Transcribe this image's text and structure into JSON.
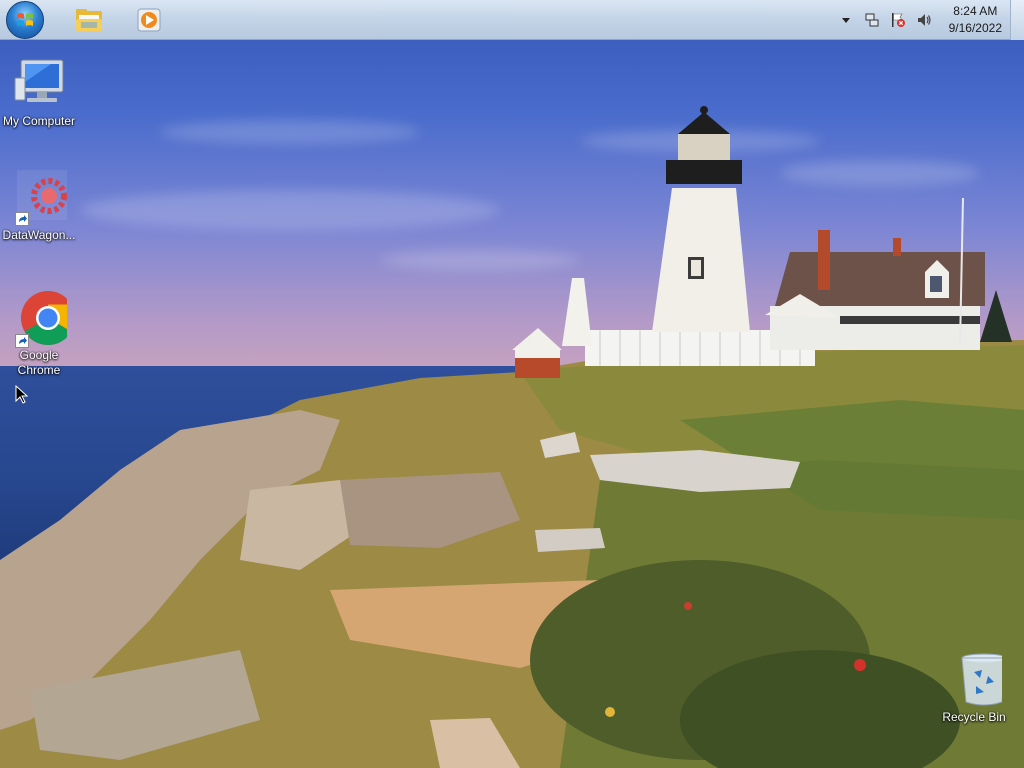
{
  "taskbar": {
    "start_button": "start-orb",
    "pinned": [
      {
        "name": "file-explorer",
        "icon": "folder-icon"
      },
      {
        "name": "media-player",
        "icon": "play-icon"
      }
    ],
    "tray": {
      "icons": [
        "show-hidden-icons-arrow",
        "network-icon",
        "action-center-flag-icon",
        "volume-icon"
      ],
      "time": "8:24 AM",
      "date": "9/16/2022"
    }
  },
  "desktop": {
    "icons": [
      {
        "label": "My Computer",
        "icon": "computer-monitor-icon"
      },
      {
        "label": "DataWagon...",
        "icon": "datawagon-gear-icon"
      },
      {
        "label": "Google Chrome",
        "icon": "chrome-icon"
      },
      {
        "label": "Recycle Bin",
        "icon": "recycle-bin-icon"
      }
    ]
  },
  "colors": {
    "taskbar_bg": "#c5d5e8",
    "sky_top": "#3558b8",
    "sea": "#27478f",
    "grass": "#8a8a3a"
  }
}
